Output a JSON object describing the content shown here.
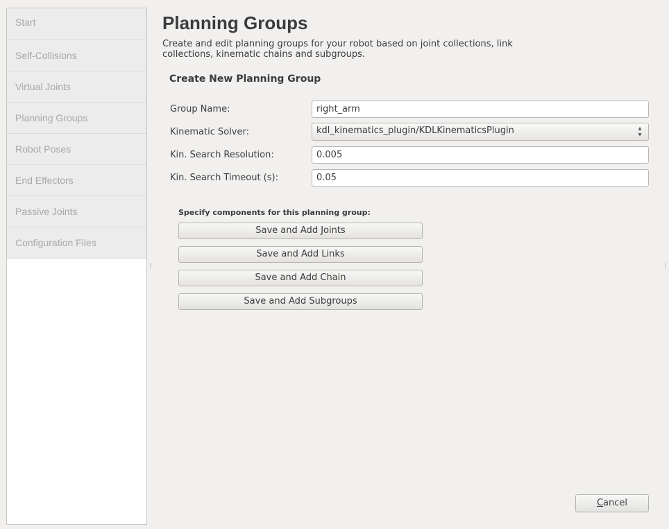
{
  "sidebar": {
    "items": [
      {
        "label": "Start"
      },
      {
        "label": "Self-Collisions"
      },
      {
        "label": "Virtual Joints"
      },
      {
        "label": "Planning Groups"
      },
      {
        "label": "Robot Poses"
      },
      {
        "label": "End Effectors"
      },
      {
        "label": "Passive Joints"
      },
      {
        "label": "Configuration Files"
      }
    ]
  },
  "header": {
    "title": "Planning Groups",
    "description_line1": "Create and edit planning groups for your robot based on joint collections, link",
    "description_line2": "collections, kinematic chains and subgroups."
  },
  "form": {
    "section_title": "Create New Planning Group",
    "group_name_label": "Group Name:",
    "group_name_value": "right_arm",
    "solver_label": "Kinematic Solver:",
    "solver_value": "kdl_kinematics_plugin/KDLKinematicsPlugin",
    "resolution_label": "Kin. Search Resolution:",
    "resolution_value": "0.005",
    "timeout_label": "Kin. Search Timeout (s):",
    "timeout_value": "0.05"
  },
  "components": {
    "label": "Specify components for this planning group:",
    "buttons": {
      "joints": "Save and Add Joints",
      "links": "Save and Add Links",
      "chain": "Save and Add Chain",
      "subgroups": "Save and Add Subgroups"
    }
  },
  "footer": {
    "cancel_first_letter": "C",
    "cancel_rest": "ancel"
  }
}
